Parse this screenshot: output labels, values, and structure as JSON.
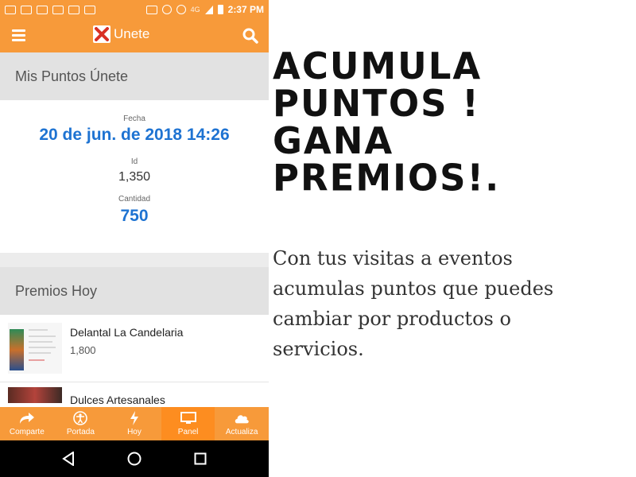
{
  "status_bar": {
    "network": "4G",
    "time": "2:37 PM"
  },
  "app_bar": {
    "title": "Unete",
    "icons": {
      "menu": "hamburger-menu-icon",
      "search": "search-icon",
      "logo": "unete-logo-icon"
    }
  },
  "points_section": {
    "header": "Mis Puntos Únete",
    "fecha_label": "Fecha",
    "fecha_value": "20 de jun. de 2018 14:26",
    "id_label": "Id",
    "id_value": "1,350",
    "cantidad_label": "Cantidad",
    "cantidad_value": "750"
  },
  "prizes_section": {
    "header": "Premios Hoy",
    "items": [
      {
        "name": "Delantal La Candelaria",
        "points": "1,800"
      },
      {
        "name": "Dulces Artesanales",
        "points": ""
      }
    ]
  },
  "bottom_nav": {
    "items": [
      {
        "label": "Comparte",
        "icon": "share-icon"
      },
      {
        "label": "Portada",
        "icon": "person-icon"
      },
      {
        "label": "Hoy",
        "icon": "lightning-icon"
      },
      {
        "label": "Panel",
        "icon": "monitor-icon",
        "active": true
      },
      {
        "label": "Actualiza",
        "icon": "cloud-icon"
      }
    ]
  },
  "system_nav": {
    "back": "back-icon",
    "home": "home-icon",
    "recents": "recents-icon"
  },
  "promo": {
    "title_lines": [
      "ACUMULA",
      "PUNTOS !",
      "GANA",
      "PREMIOS!."
    ],
    "body": "Con tus visitas a eventos acumulas puntos que puedes cambiar por productos o servicios."
  },
  "colors": {
    "accent_orange": "#f79a3a",
    "active_orange": "#fd8d20",
    "link_blue": "#1e73d2",
    "section_gray": "#e2e2e2"
  }
}
